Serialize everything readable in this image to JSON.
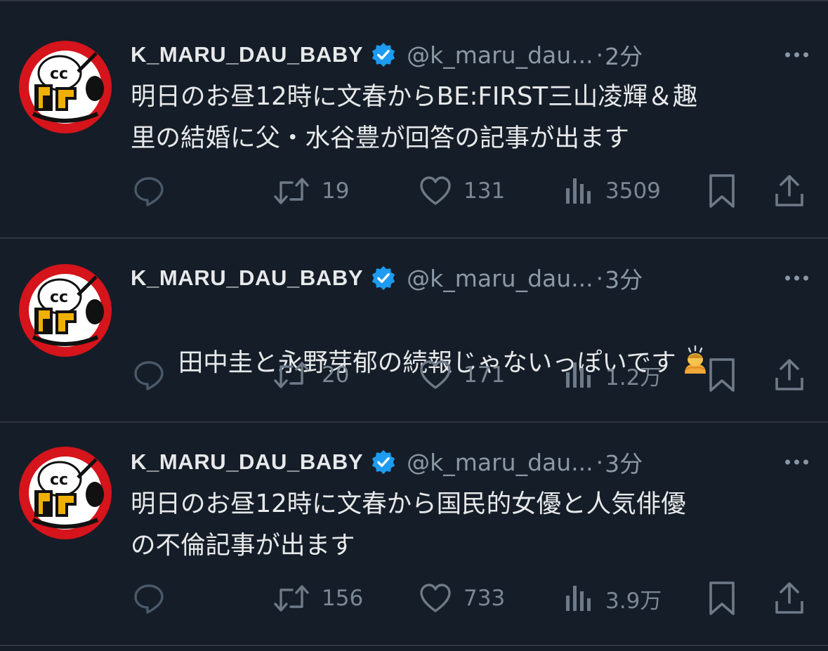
{
  "tweets": [
    {
      "display_name": "K_MARU_DAU_BABY",
      "handle": "@k_maru_dau...",
      "separator": "·",
      "time": "2分",
      "text": "明日のお昼12時に文春からBE:FIRST三山凌輝＆趣\n里の結婚に父・水谷豊が回答の記事が出ます",
      "retweets": "19",
      "likes": "131",
      "views": "3509"
    },
    {
      "display_name": "K_MARU_DAU_BABY",
      "handle": "@k_maru_dau...",
      "separator": "·",
      "time": "3分",
      "text": "田中圭と永野芽郁の続報じゃないっぽいです",
      "emoji": "person-bowing-emoji",
      "retweets": "20",
      "likes": "171",
      "views": "1.2万"
    },
    {
      "display_name": "K_MARU_DAU_BABY",
      "handle": "@k_maru_dau...",
      "separator": "·",
      "time": "3分",
      "text": "明日のお昼12時に文春から国民的女優と人気俳優\nの不倫記事が出ます",
      "retweets": "156",
      "likes": "733",
      "views": "3.9万"
    }
  ],
  "colors": {
    "background": "#151d28",
    "divider": "#2f3640",
    "text": "#e7e9ea",
    "secondary": "#8b98a5",
    "verified": "#1d9bf0",
    "avatar_red": "#d5141b"
  },
  "icons": [
    "reply-icon",
    "retweet-icon",
    "like-icon",
    "views-icon",
    "bookmark-icon",
    "share-icon",
    "verified-badge-icon",
    "more-options-icon"
  ]
}
